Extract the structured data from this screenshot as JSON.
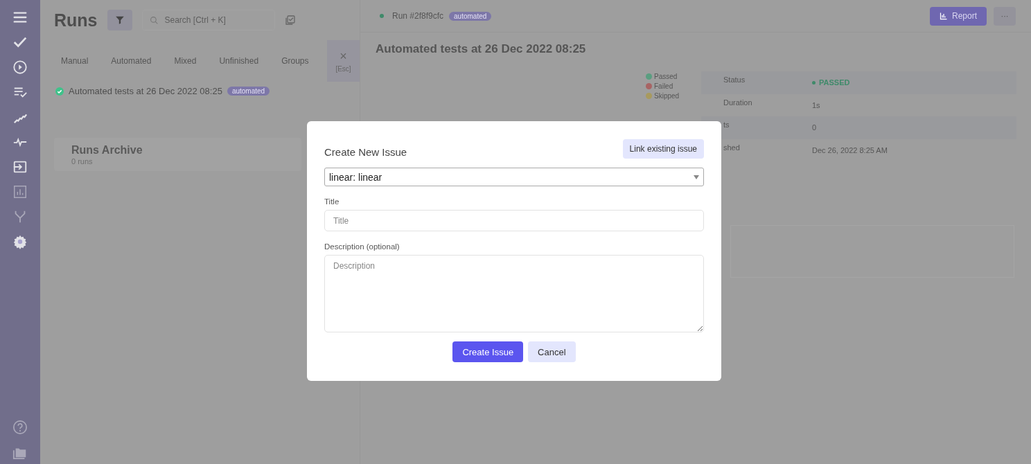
{
  "runs_panel": {
    "title": "Runs",
    "search": {
      "placeholder": "Search [Ctrl + K]"
    },
    "tabs": [
      {
        "label": "Manual",
        "selected": false
      },
      {
        "label": "Automated",
        "selected": false
      },
      {
        "label": "Mixed",
        "selected": false
      },
      {
        "label": "Unfinished",
        "selected": false
      },
      {
        "label": "Groups",
        "selected": false
      }
    ],
    "close": {
      "icon": "×",
      "hint": "[Esc]"
    },
    "runs": [
      {
        "title": "Automated tests at 26 Dec 2022 08:25",
        "badge": "automated",
        "passed": true
      }
    ],
    "archive": {
      "title": "Runs Archive",
      "count": "0 runs"
    }
  },
  "run_detail": {
    "run_label": "Run #2f8f9cfc",
    "badge": "automated",
    "report_button": "Report",
    "more_button": "···",
    "title": "Automated tests at 26 Dec 2022 08:25",
    "legend": [
      {
        "label": "Passed",
        "color": "#5a9e80"
      },
      {
        "label": "Failed",
        "color": "#a86464"
      },
      {
        "label": "Skipped",
        "color": "#a89a5e"
      }
    ],
    "stats": [
      {
        "label": "Status",
        "value": "PASSED",
        "kind": "status"
      },
      {
        "label": "Duration",
        "value": "1s",
        "kind": "text"
      },
      {
        "label": "ts",
        "value": "0",
        "kind": "text"
      },
      {
        "label": "shed",
        "value": "Dec 26, 2022 8:25 AM",
        "kind": "text"
      }
    ]
  },
  "modal": {
    "title": "Create New Issue",
    "link_button": "Link existing issue",
    "select_value": "linear: linear",
    "title_label": "Title",
    "title_placeholder": "Title",
    "description_label": "Description (optional)",
    "description_placeholder": "Description",
    "primary_button": "Create Issue",
    "cancel_button": "Cancel"
  }
}
